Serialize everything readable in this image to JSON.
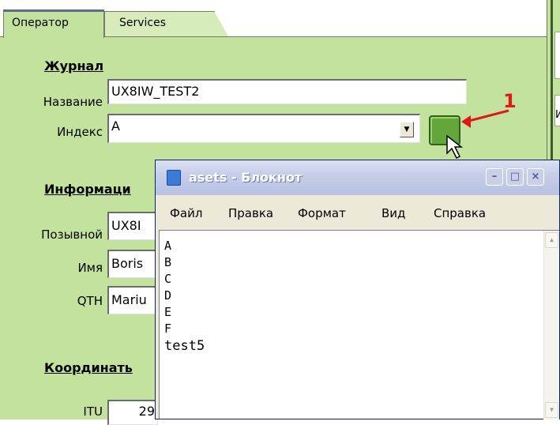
{
  "tabs": [
    {
      "label": "Оператор",
      "active": true
    },
    {
      "label": "Services",
      "active": false
    }
  ],
  "journal": {
    "section_title": "Журнал",
    "name_label": "Название",
    "name_value": "UX8IW_TEST2",
    "index_label": "Индекс",
    "index_value": "A",
    "annotation": "1"
  },
  "info": {
    "section_title": "Информаци",
    "callsign_label": "Позывной",
    "callsign_value": "UX8I",
    "name_label": "Имя",
    "name_value": "Boris",
    "qth_label": "QTH",
    "qth_value": "Mariu"
  },
  "coords": {
    "section_title": "Координать",
    "itu_label": "ITU",
    "itu_value": "29"
  },
  "gutter_glyph": "И",
  "notepad": {
    "title": "asets - Блокнот",
    "menu": [
      "Файл",
      "Правка",
      "Формат",
      "Вид",
      "Справка"
    ],
    "lines": [
      "A",
      "B",
      "C",
      "D",
      "E",
      "F",
      "test5"
    ]
  },
  "colors": {
    "panel_bg": "#c2e29d",
    "accent_button": "#63a73a",
    "annotation": "#e21818"
  }
}
